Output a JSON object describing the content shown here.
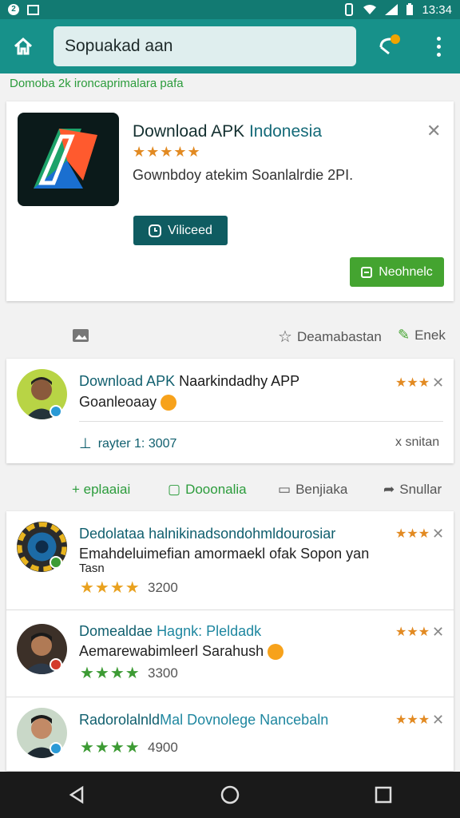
{
  "status_bar": {
    "time": "13:34"
  },
  "search": {
    "value": "Sopuakad aan"
  },
  "subheader": "Domoba 2k ironcaprimalara pafa",
  "ad": {
    "title_part1": "Download APK ",
    "title_part2": "Indonesia",
    "stars": "★★★★★",
    "description": "Gownbdoy atekim Soanlalrdie 2PI.",
    "verified_label": "Viliceed",
    "install_label": "Neohnelc"
  },
  "row_icons": {
    "center_label": "Deamabastan",
    "right_label": "Enek"
  },
  "top_review": {
    "title_part1": "Download APK ",
    "title_part2": "Naarkindadhy APP",
    "subtitle": "Goanleoaay",
    "stars": "★★★",
    "meta_left": "rayter 1: 3007",
    "meta_right": "x snitan"
  },
  "actions": {
    "a1": "+ eplaaiai",
    "a2": "Dooonalia",
    "a3": "Benjiaka",
    "a4": "Snullar"
  },
  "list": [
    {
      "title": "Dedolataa halnikinadsondohmldourosiar",
      "subtitle": "Emahdeluimefian amormaekl ofak Sopon yan",
      "subtitle2": "Tasn",
      "stars": "★★★★",
      "count": "3200",
      "rating": "★★★"
    },
    {
      "title_part1": "Domealdae ",
      "title_part2": "Hagnk: Pleldadk",
      "subtitle": "Aemarewabimleerl Sarahush",
      "stars": "★★★★",
      "count": "3300",
      "rating": "★★★"
    },
    {
      "title_part1": "Radorolalnld",
      "title_part2": "Mal Dovnolege Nancebaln",
      "stars": "★★★★",
      "count": "4900",
      "rating": "★★★"
    }
  ],
  "colors": {
    "primary": "#17918a",
    "statusbar": "#127a72",
    "accent_green": "#44a430",
    "star_orange": "#e28a22"
  }
}
